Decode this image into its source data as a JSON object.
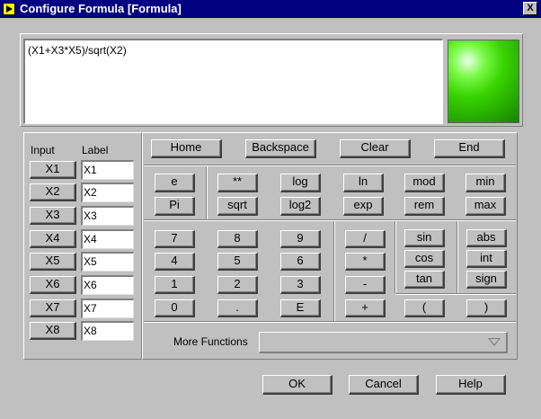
{
  "window": {
    "title": "Configure Formula [Formula]",
    "close_label": "X"
  },
  "formula": {
    "value": "(X1+X3*X5)/sqrt(X2)"
  },
  "inputs": {
    "header_input": "Input",
    "header_label": "Label",
    "rows": [
      {
        "button": "X1",
        "label": "X1"
      },
      {
        "button": "X2",
        "label": "X2"
      },
      {
        "button": "X3",
        "label": "X3"
      },
      {
        "button": "X4",
        "label": "X4"
      },
      {
        "button": "X5",
        "label": "X5"
      },
      {
        "button": "X6",
        "label": "X6"
      },
      {
        "button": "X7",
        "label": "X7"
      },
      {
        "button": "X8",
        "label": "X8"
      }
    ]
  },
  "edit": {
    "home": "Home",
    "backspace": "Backspace",
    "clear": "Clear",
    "end": "End"
  },
  "consts": {
    "e": "e",
    "pi": "Pi"
  },
  "funcs": {
    "pow": "**",
    "log": "log",
    "ln": "ln",
    "mod": "mod",
    "min": "min",
    "sqrt": "sqrt",
    "log2": "log2",
    "exp": "exp",
    "rem": "rem",
    "max": "max"
  },
  "digits": [
    "7",
    "8",
    "9",
    "4",
    "5",
    "6",
    "1",
    "2",
    "3",
    "0",
    ".",
    "E"
  ],
  "ops": {
    "div": "/",
    "mul": "*",
    "sub": "-",
    "add": "+"
  },
  "trig": {
    "sin": "sin",
    "cos": "cos",
    "tan": "tan"
  },
  "misc": {
    "abs": "abs",
    "int": "int",
    "sign": "sign"
  },
  "parens": {
    "open": "(",
    "close": ")"
  },
  "more": {
    "label": "More Functions",
    "selected": ""
  },
  "dialog": {
    "ok": "OK",
    "cancel": "Cancel",
    "help": "Help"
  },
  "colors": {
    "title_bar": "#000080",
    "face": "#c0c0c0",
    "led": "#38d400"
  }
}
